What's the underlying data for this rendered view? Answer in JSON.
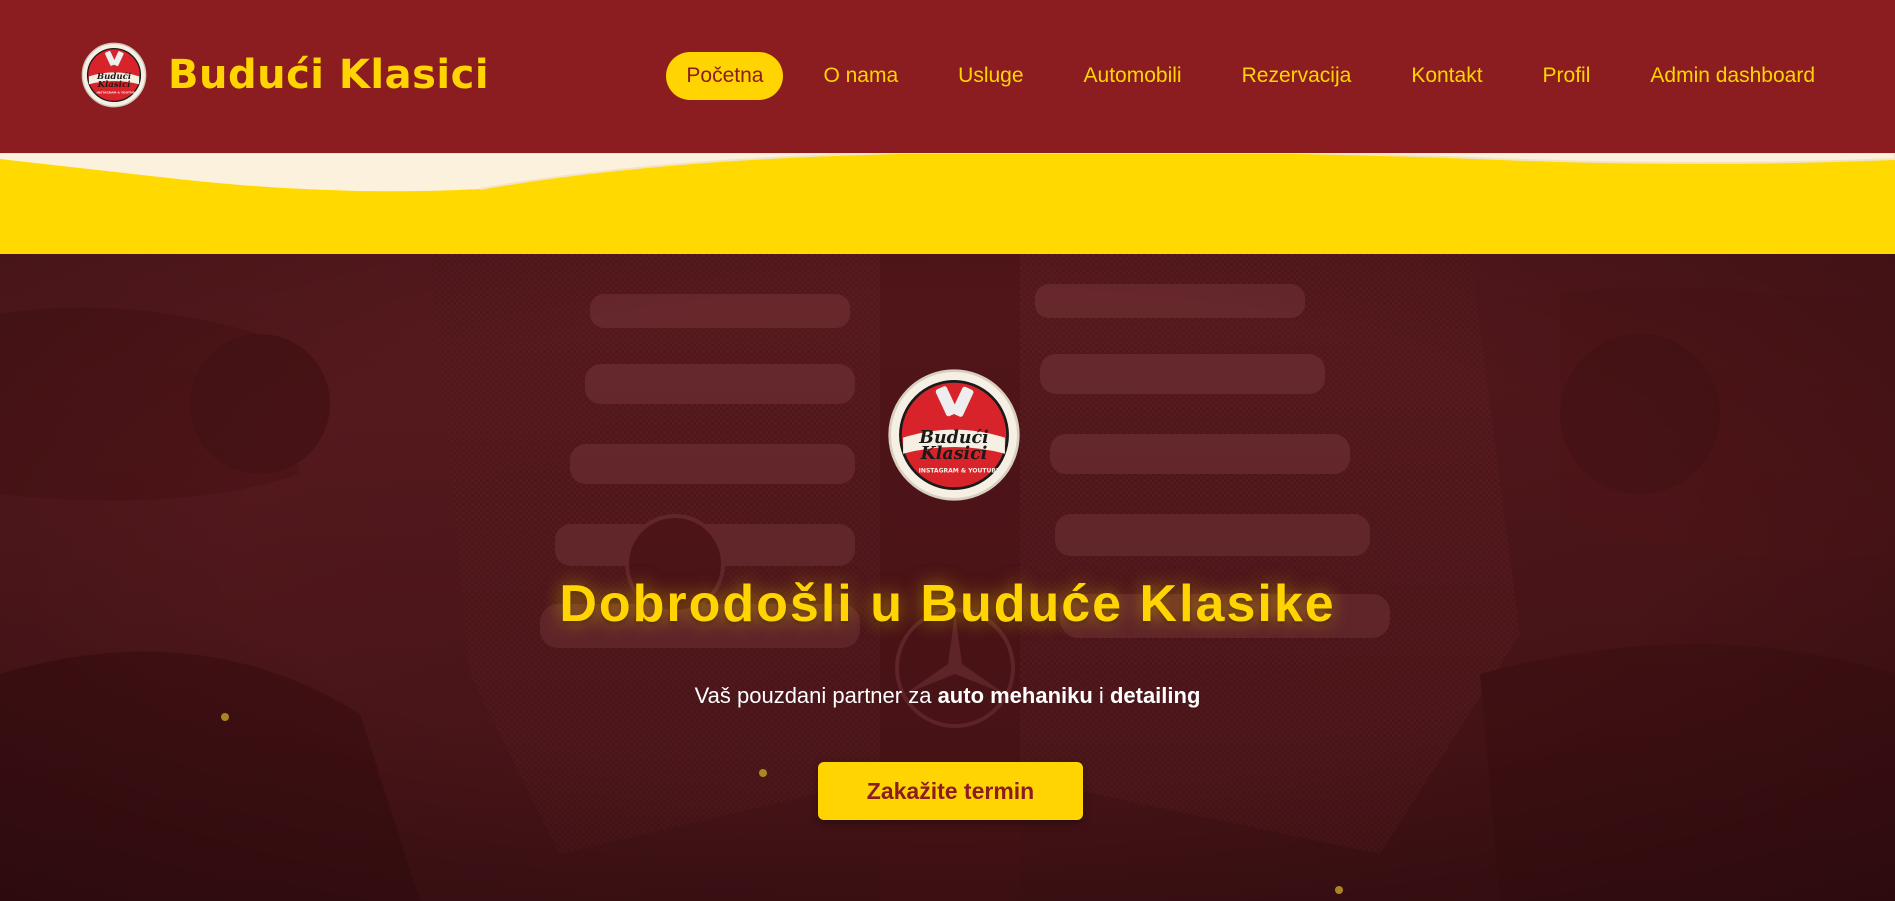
{
  "header": {
    "brand_name": "Budući Klasici",
    "logo_text_line1": "Budući",
    "logo_text_line2": "Klasici",
    "logo_text_line3": "INSTAGRAM & YOUTUBE"
  },
  "nav": {
    "items": [
      {
        "label": "Početna",
        "active": true
      },
      {
        "label": "O nama"
      },
      {
        "label": "Usluge"
      },
      {
        "label": "Automobili"
      },
      {
        "label": "Rezervacija"
      },
      {
        "label": "Kontakt"
      },
      {
        "label": "Profil"
      },
      {
        "label": "Admin dashboard"
      }
    ]
  },
  "hero": {
    "title": "Dobrodošli u Buduće Klasike",
    "subtitle_prefix": "Vaš pouzdani partner za ",
    "subtitle_bold_1": "auto mehaniku",
    "subtitle_middle": " i ",
    "subtitle_bold_2": "detailing",
    "cta_label": "Zakažite termin",
    "background": "engine-bay-photo"
  },
  "colors": {
    "header_bg": "#8b1d21",
    "accent_yellow": "#ffd400",
    "cream_wave": "#fbf1dd",
    "text_white": "#ffffff"
  }
}
